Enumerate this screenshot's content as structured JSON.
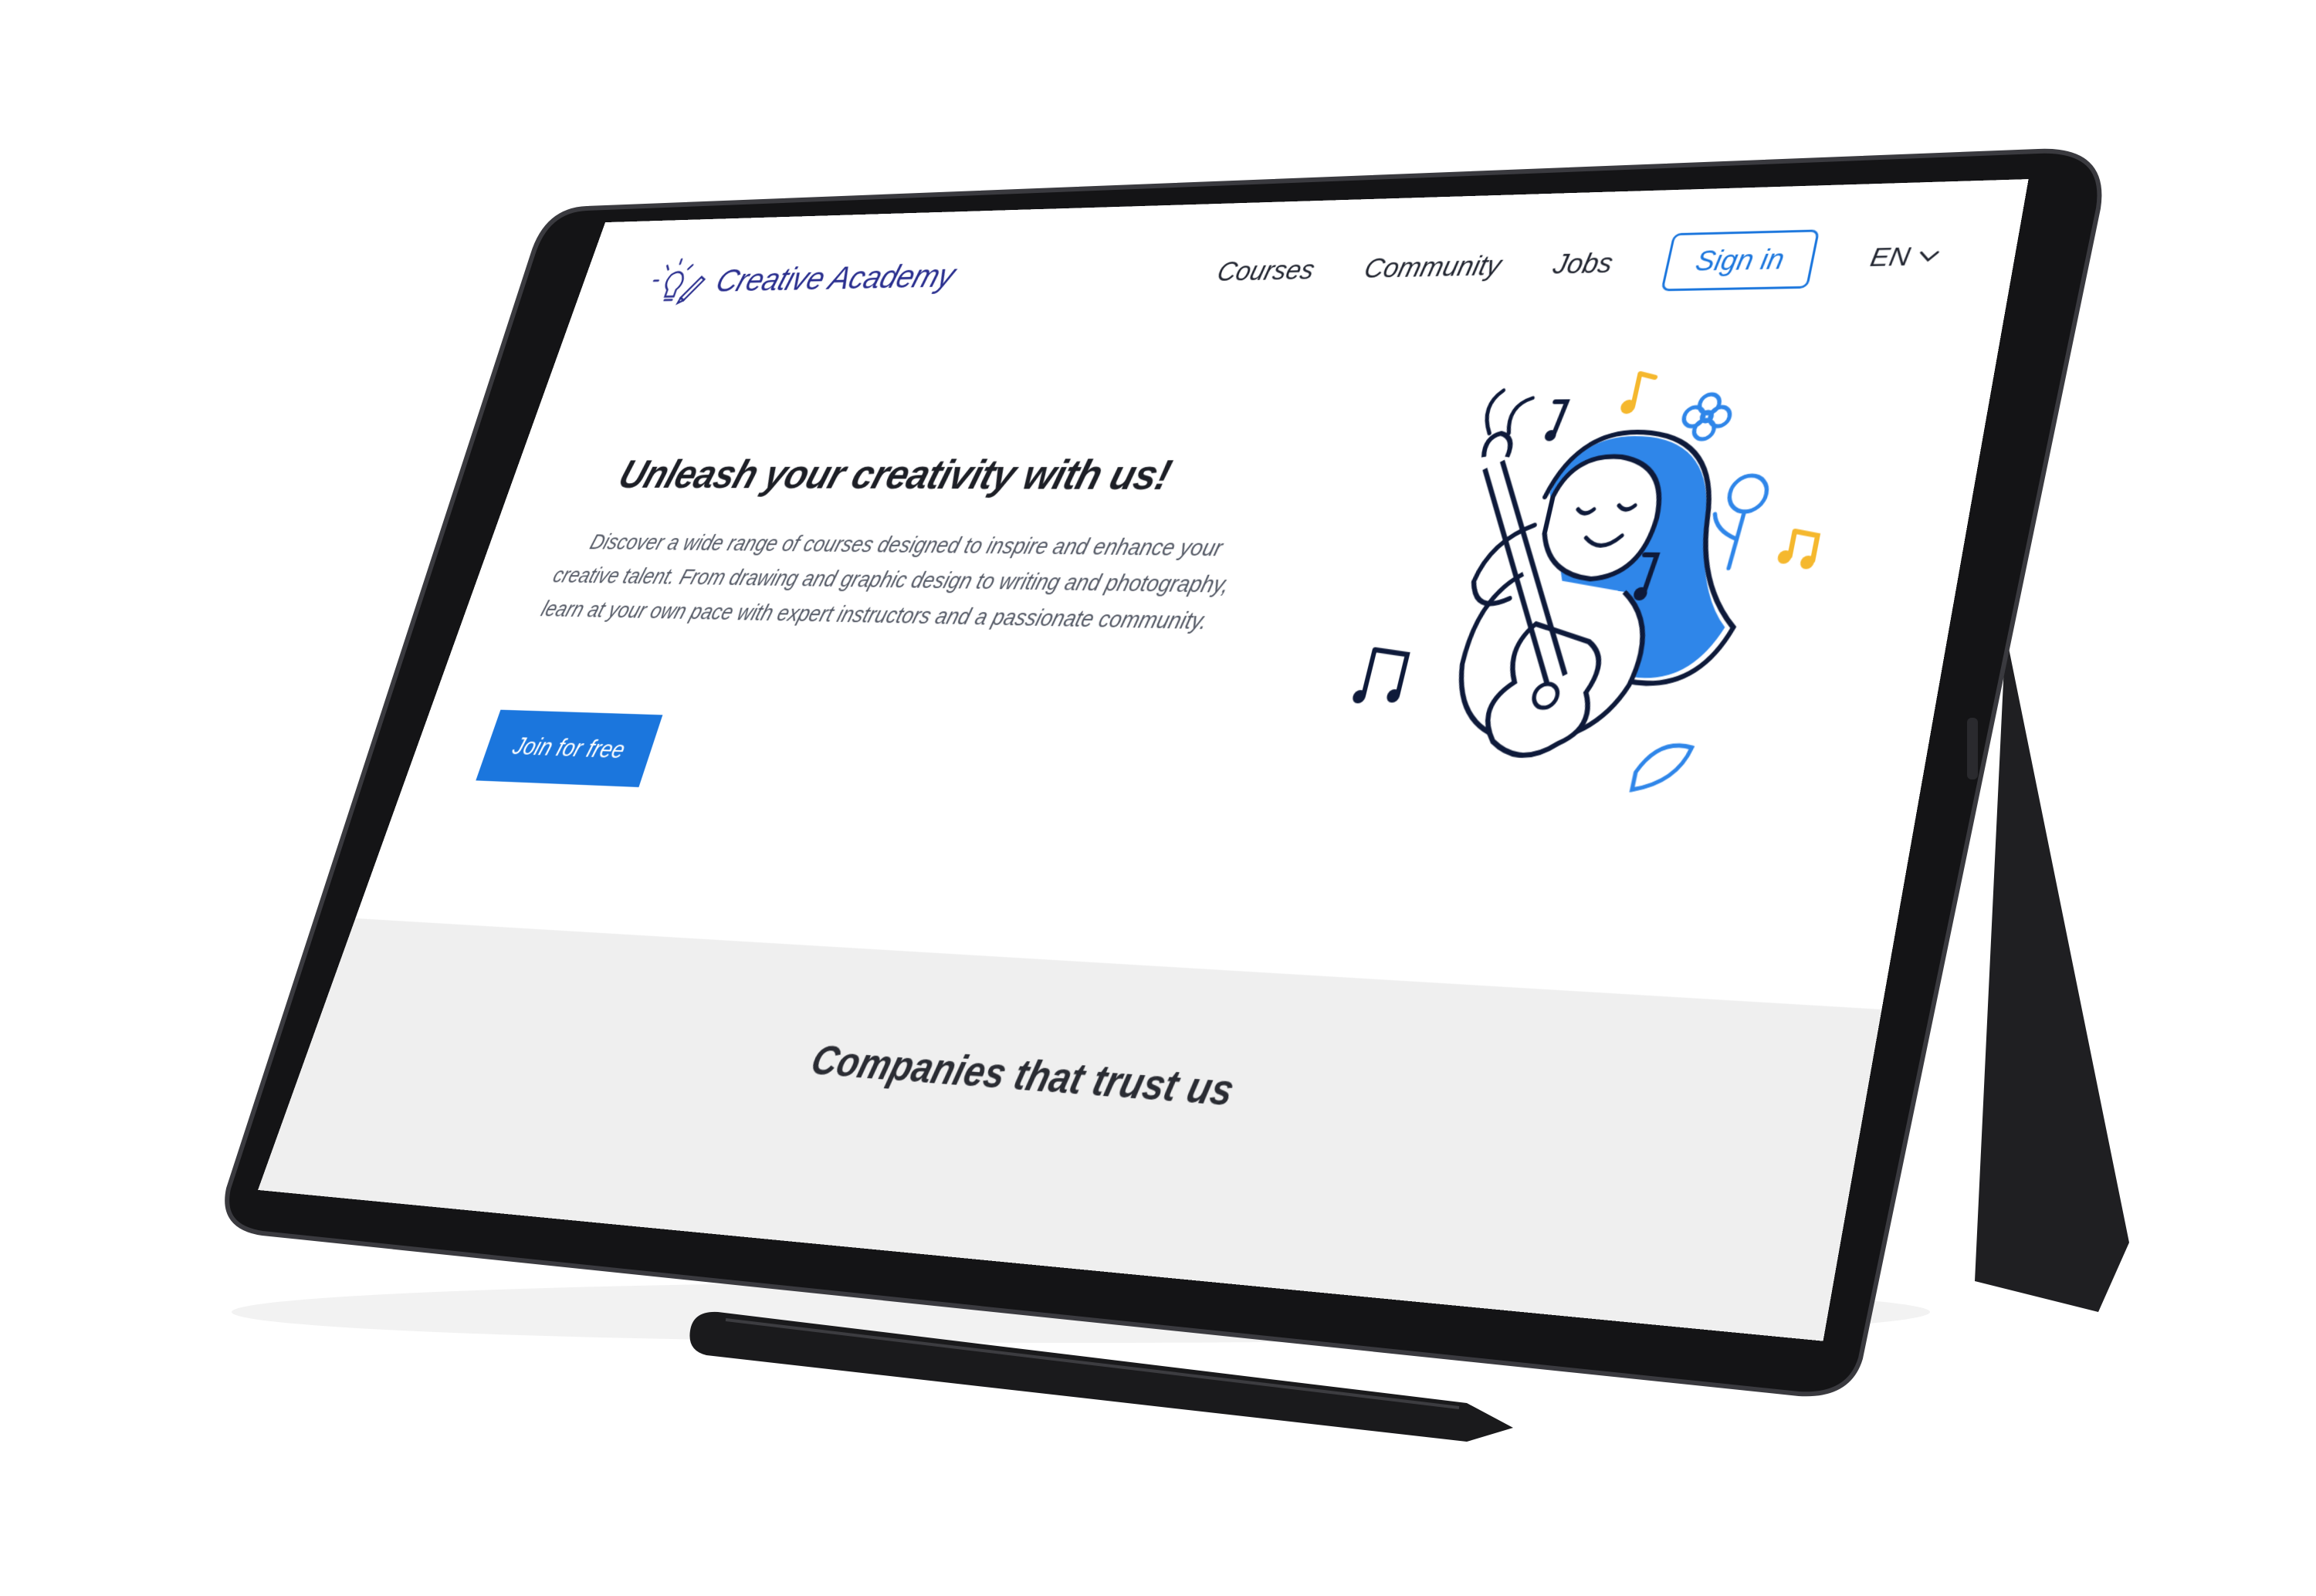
{
  "brand": {
    "name": "Creative Academy",
    "logo_icon": "lightbulb-pencil-icon",
    "color": "#2a2f8f"
  },
  "nav": {
    "courses": "Courses",
    "community": "Community",
    "jobs": "Jobs",
    "sign_in": "Sign in",
    "language": "EN",
    "language_icon": "chevron-down-icon"
  },
  "hero": {
    "title": "Unleash your creativity with us!",
    "description": "Discover a wide range of courses designed to inspire and enhance your creative talent. From drawing and graphic design to writing and photography, learn at your own pace with expert instructors and a passionate community.",
    "cta": "Join for free",
    "illustration": "girl-playing-guitar-illustration"
  },
  "trust": {
    "title": "Companies that trust us"
  },
  "colors": {
    "accent": "#1b76dd",
    "navy": "#0e1a3a",
    "note_yellow": "#f5b82e",
    "band_gray": "#efefef"
  }
}
